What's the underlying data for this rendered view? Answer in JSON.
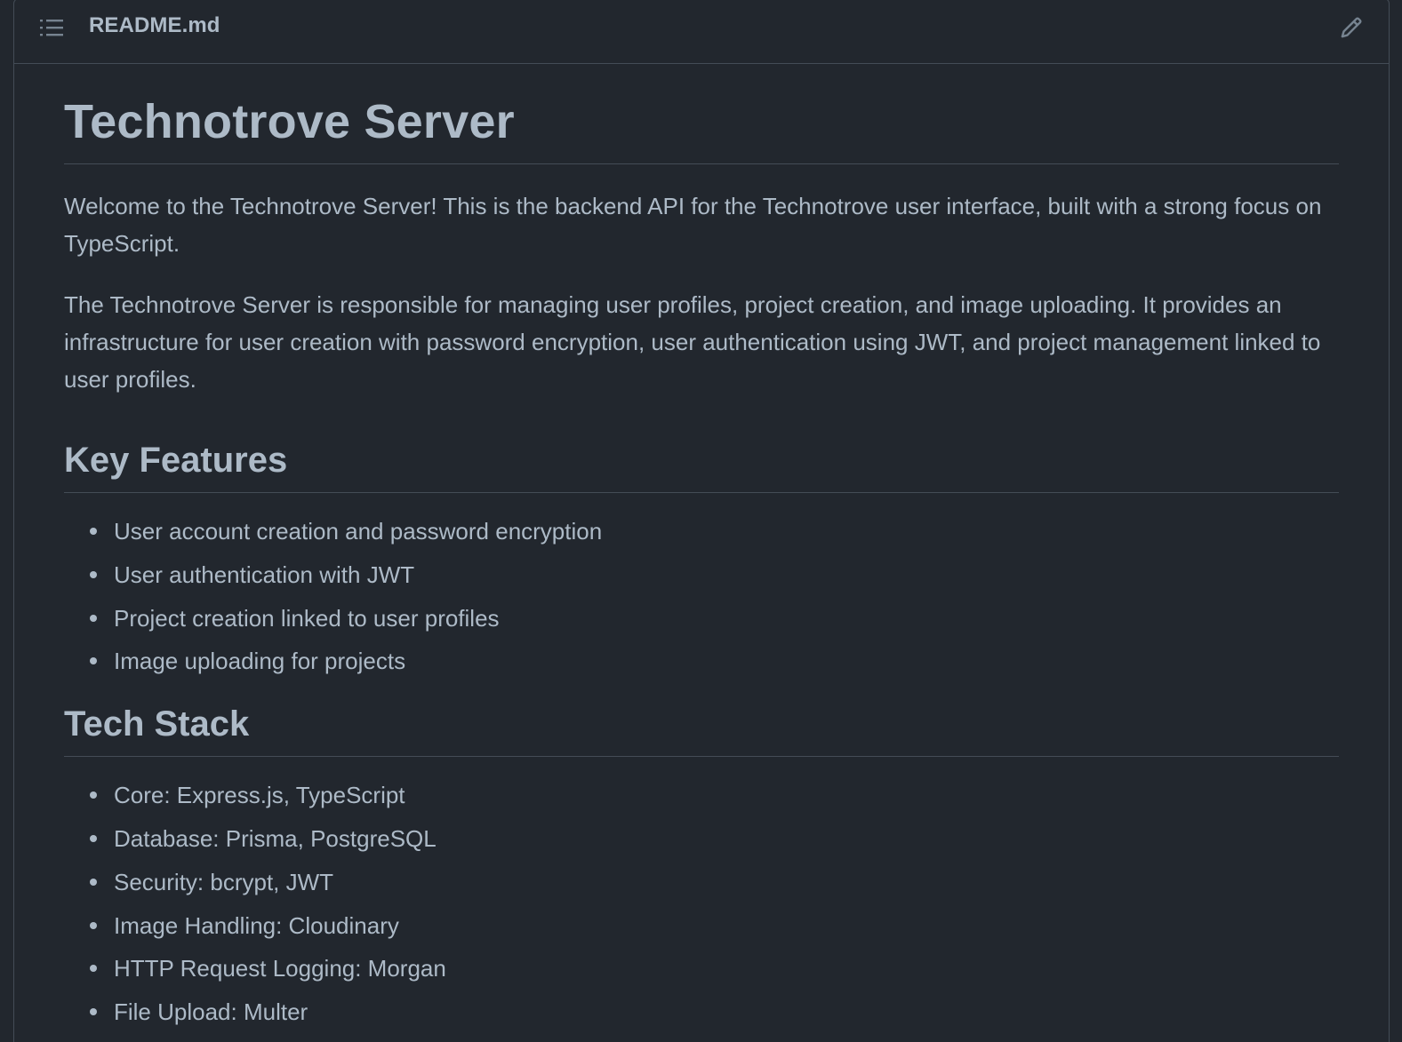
{
  "file": {
    "name": "README.md",
    "toc_icon": "list-unordered-icon",
    "edit_icon": "pencil-icon"
  },
  "readme": {
    "title": "Technotrove Server",
    "intro_paragraphs": [
      "Welcome to the Technotrove Server! This is the backend API for the Technotrove user interface, built with a strong focus on TypeScript.",
      "The Technotrove Server is responsible for managing user profiles, project creation, and image uploading. It provides an infrastructure for user creation with password encryption, user authentication using JWT, and project management linked to user profiles."
    ],
    "key_features": {
      "heading": "Key Features",
      "items": [
        "User account creation and password encryption",
        "User authentication with JWT",
        "Project creation linked to user profiles",
        "Image uploading for projects"
      ]
    },
    "tech_stack": {
      "heading": "Tech Stack",
      "items": [
        "Core: Express.js, TypeScript",
        "Database: Prisma, PostgreSQL",
        "Security: bcrypt, JWT",
        "Image Handling: Cloudinary",
        "HTTP Request Logging: Morgan",
        "File Upload: Multer"
      ]
    }
  }
}
